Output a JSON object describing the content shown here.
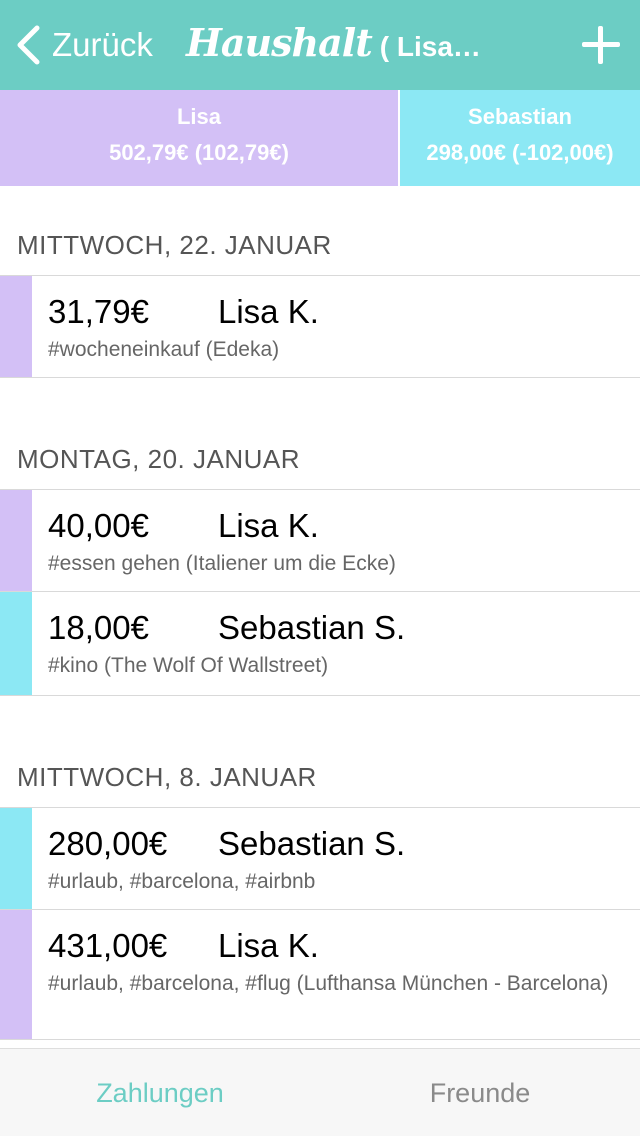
{
  "navbar": {
    "back_label": "Zurück",
    "title": "Haushalt",
    "subtitle": "( Lisa…",
    "add_icon": "plus-icon",
    "back_icon": "chevron-left-icon",
    "color": "#6ccdc4"
  },
  "balances": [
    {
      "name": "Lisa",
      "amount": "502,79€ (102,79€)",
      "color": "#d3c0f6"
    },
    {
      "name": "Sebastian",
      "amount": "298,00€ (-102,00€)",
      "color": "#8ce8f4"
    }
  ],
  "sections": [
    {
      "date": "MITTWOCH, 22. JANUAR",
      "payments": [
        {
          "amount": "31,79€",
          "person": "Lisa K.",
          "note": "#wocheneinkauf (Edeka)"
        }
      ]
    },
    {
      "date": "MONTAG, 20. JANUAR",
      "payments": [
        {
          "amount": "40,00€",
          "person": "Lisa K.",
          "note": "#essen gehen (Italiener um die Ecke)"
        },
        {
          "amount": "18,00€",
          "person": "Sebastian S.",
          "note": "#kino (The Wolf Of Wallstreet)"
        }
      ]
    },
    {
      "date": "MITTWOCH, 8. JANUAR",
      "payments": [
        {
          "amount": "280,00€",
          "person": "Sebastian S.",
          "note": "#urlaub, #barcelona, #airbnb"
        },
        {
          "amount": "431,00€",
          "person": "Lisa K.",
          "note": "#urlaub, #barcelona, #flug (Lufthansa München - Barcelona)"
        }
      ]
    }
  ],
  "tabs": [
    {
      "label": "Zahlungen",
      "active": true
    },
    {
      "label": "Freunde",
      "active": false
    }
  ]
}
